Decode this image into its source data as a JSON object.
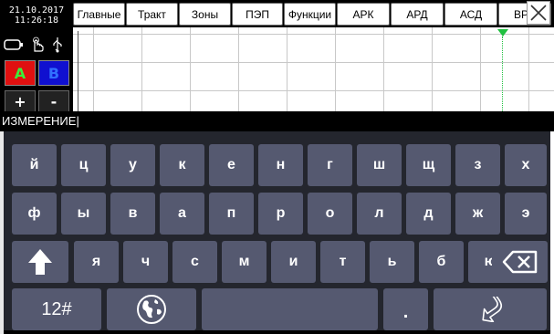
{
  "status": {
    "date": "21.10.2017",
    "time": "11:26:18",
    "icons": [
      "battery-icon",
      "touch-hand-icon",
      "usb-icon"
    ]
  },
  "channels": {
    "a_label": "A",
    "b_label": "B",
    "plus_label": "+",
    "minus_label": "-"
  },
  "menu": {
    "tabs": [
      "Главные",
      "Тракт",
      "Зоны",
      "ПЭП",
      "Функции",
      "АРК",
      "АРД",
      "АСД",
      "ВРЧ"
    ]
  },
  "entry": {
    "value": "ИЗМЕРЕНИЕ|"
  },
  "keyboard": {
    "row1": [
      "й",
      "ц",
      "у",
      "к",
      "е",
      "н",
      "г",
      "ш",
      "щ",
      "з",
      "х"
    ],
    "row2": [
      "ф",
      "ы",
      "в",
      "а",
      "п",
      "р",
      "о",
      "л",
      "д",
      "ж",
      "э"
    ],
    "row3": [
      "я",
      "ч",
      "с",
      "м",
      "и",
      "т",
      "ь",
      "б",
      "ю"
    ],
    "numbers_label": "12#",
    "dot_label": ".",
    "colors": {
      "background": "#24262e",
      "key": "#555970",
      "key_text": "#ffffff"
    }
  },
  "colors": {
    "a_button": "#e01010",
    "b_button": "#1010d0",
    "gate": "#20c040"
  }
}
